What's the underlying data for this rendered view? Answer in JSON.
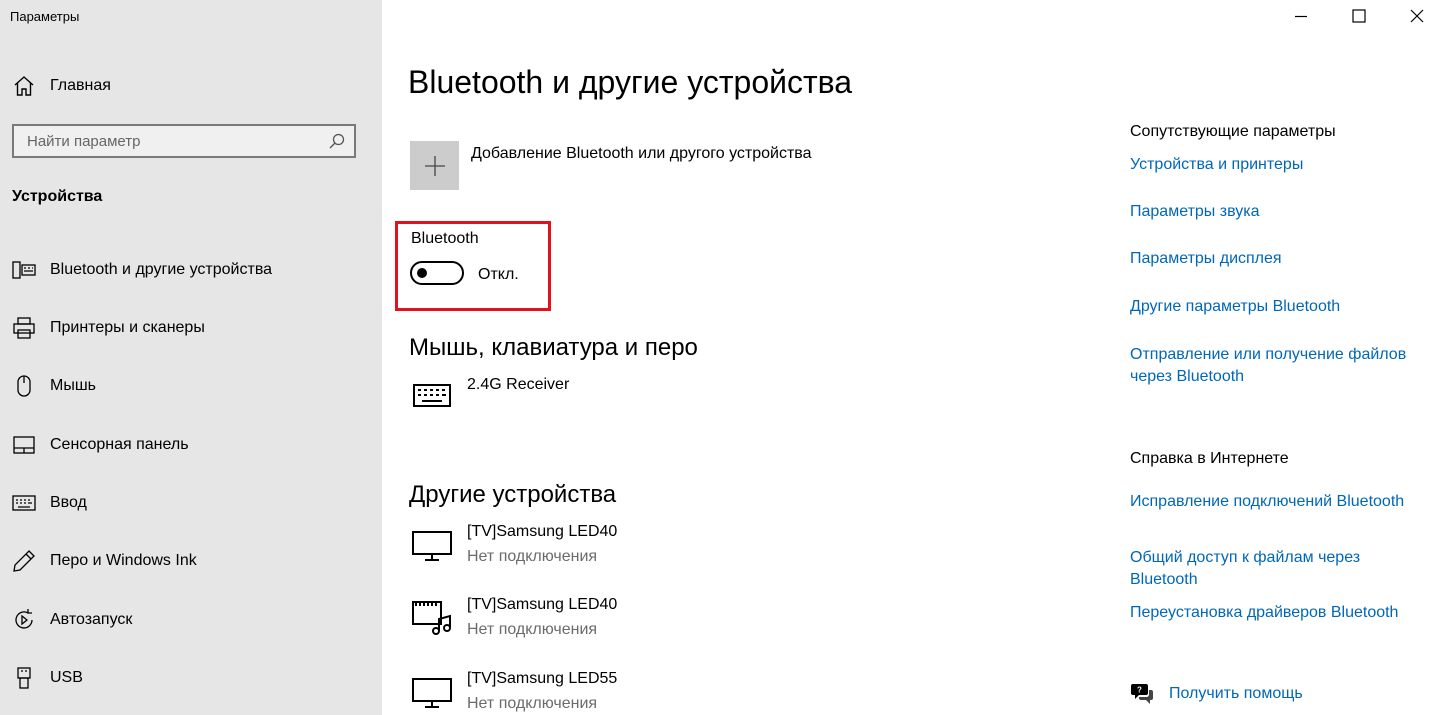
{
  "window": {
    "title": "Параметры",
    "controls": [
      "minimize-icon",
      "maximize-icon",
      "close-icon"
    ]
  },
  "sidebar": {
    "home_label": "Главная",
    "search_placeholder": "Найти параметр",
    "section_title": "Устройства",
    "items": [
      {
        "label": "Bluetooth и другие устройства",
        "icon": "bluetooth-devices-icon"
      },
      {
        "label": "Принтеры и сканеры",
        "icon": "printer-icon"
      },
      {
        "label": "Мышь",
        "icon": "mouse-icon"
      },
      {
        "label": "Сенсорная панель",
        "icon": "touchpad-icon"
      },
      {
        "label": "Ввод",
        "icon": "keyboard-icon"
      },
      {
        "label": "Перо и Windows Ink",
        "icon": "pen-icon"
      },
      {
        "label": "Автозапуск",
        "icon": "autoplay-icon"
      },
      {
        "label": "USB",
        "icon": "usb-icon"
      }
    ]
  },
  "main": {
    "title": "Bluetooth и другие устройства",
    "add_device_label": "Добавление Bluetooth или другого устройства",
    "bluetooth": {
      "label": "Bluetooth",
      "state_label": "Откл.",
      "on": false
    },
    "groups": [
      {
        "title": "Мышь, клавиатура и перо",
        "devices": [
          {
            "name": "2.4G Receiver",
            "status": "",
            "icon": "keyboard-icon"
          }
        ]
      },
      {
        "title": "Другие устройства",
        "devices": [
          {
            "name": "[TV]Samsung LED40",
            "status": "Нет подключения",
            "icon": "monitor-icon"
          },
          {
            "name": "[TV]Samsung LED40",
            "status": "Нет подключения",
            "icon": "media-device-icon"
          },
          {
            "name": "[TV]Samsung LED55",
            "status": "Нет подключения",
            "icon": "monitor-icon"
          }
        ]
      }
    ]
  },
  "related": {
    "heading": "Сопутствующие параметры",
    "links": [
      "Устройства и принтеры",
      "Параметры звука",
      "Параметры дисплея",
      "Другие параметры Bluetooth",
      "Отправление или получение файлов через Bluetooth"
    ]
  },
  "web_help": {
    "heading": "Справка в Интернете",
    "links": [
      "Исправление подключений Bluetooth",
      "Общий доступ к файлам через Bluetooth",
      "Переустановка драйверов Bluetooth"
    ]
  },
  "get_help": {
    "label": "Получить помощь",
    "icon": "help-chat-icon"
  },
  "colors": {
    "sidebar_bg": "#e6e6e6",
    "link": "#0067b8",
    "highlight": "#e3101e",
    "tile_bg": "#cccccc"
  }
}
